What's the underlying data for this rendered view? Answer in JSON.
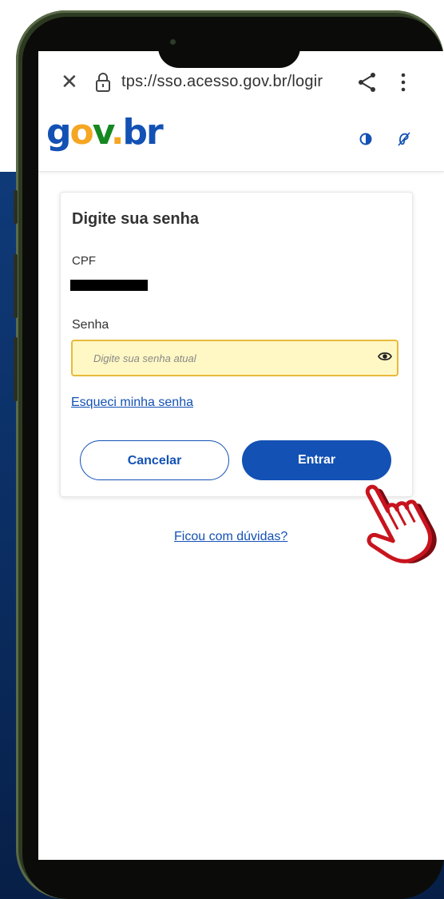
{
  "browser": {
    "url_text": "tps://sso.acesso.gov.br/logir"
  },
  "site": {
    "logo_parts": {
      "g": "g",
      "o": "o",
      "v": "v",
      "dot": ".",
      "br": "br"
    },
    "logo_text": "gov.br"
  },
  "login_card": {
    "title": "Digite sua senha",
    "cpf_label": "CPF",
    "password_label": "Senha",
    "password_placeholder": "Digite sua senha atual",
    "password_value": "",
    "forgot_link": "Esqueci minha senha",
    "cancel_button": "Cancelar",
    "submit_button": "Entrar"
  },
  "help_link": "Ficou com dúvidas?",
  "colors": {
    "brand_blue": "#1351b4",
    "field_highlight": "#fff8c4",
    "field_border": "#e8b93c",
    "cursor_red": "#c8141e",
    "background_blue": "#0b2e63"
  },
  "icons": [
    "close-icon",
    "lock-icon",
    "share-icon",
    "more-vert-icon",
    "contrast-icon",
    "accessibility-hands-icon",
    "eye-icon",
    "hand-pointer-cursor-icon"
  ]
}
